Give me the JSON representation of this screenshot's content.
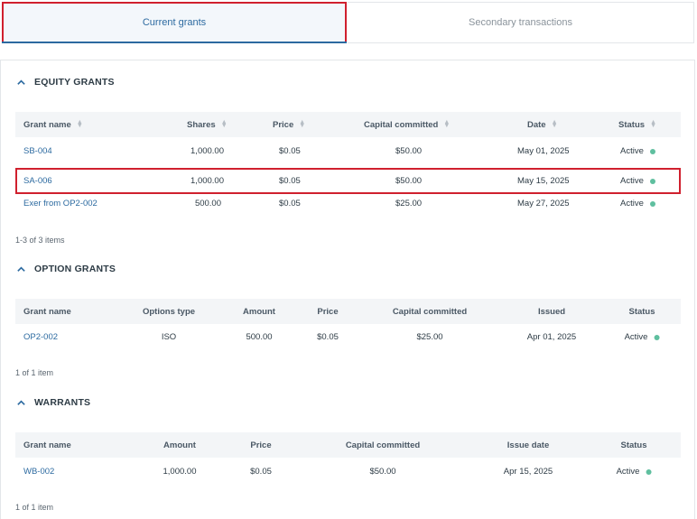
{
  "tabs": {
    "current": "Current grants",
    "secondary": "Secondary transactions"
  },
  "equity": {
    "title": "EQUITY GRANTS",
    "columns": [
      "Grant name",
      "Shares",
      "Price",
      "Capital committed",
      "Date",
      "Status"
    ],
    "rows": [
      {
        "name": "SB-004",
        "shares": "1,000.00",
        "price": "$0.05",
        "capital": "$50.00",
        "date": "May 01, 2025",
        "status": "Active"
      },
      {
        "name": "SA-006",
        "shares": "1,000.00",
        "price": "$0.05",
        "capital": "$50.00",
        "date": "May 15, 2025",
        "status": "Active"
      },
      {
        "name": "Exer from OP2-002",
        "shares": "500.00",
        "price": "$0.05",
        "capital": "$25.00",
        "date": "May 27, 2025",
        "status": "Active"
      }
    ],
    "count": "1-3 of 3 items"
  },
  "options": {
    "title": "OPTION GRANTS",
    "columns": [
      "Grant name",
      "Options type",
      "Amount",
      "Price",
      "Capital committed",
      "Issued",
      "Status"
    ],
    "rows": [
      {
        "name": "OP2-002",
        "type": "ISO",
        "amount": "500.00",
        "price": "$0.05",
        "capital": "$25.00",
        "issued": "Apr 01, 2025",
        "status": "Active"
      }
    ],
    "count": "1 of 1 item"
  },
  "warrants": {
    "title": "WARRANTS",
    "columns": [
      "Grant name",
      "Amount",
      "Price",
      "Capital committed",
      "Issue date",
      "Status"
    ],
    "rows": [
      {
        "name": "WB-002",
        "amount": "1,000.00",
        "price": "$0.05",
        "capital": "$50.00",
        "issue_date": "Apr 15, 2025",
        "status": "Active"
      }
    ],
    "count": "1 of 1 item"
  },
  "colors": {
    "accent": "#2c6aa0",
    "highlight": "#d0202e",
    "status_active": "#5fbf9f"
  }
}
